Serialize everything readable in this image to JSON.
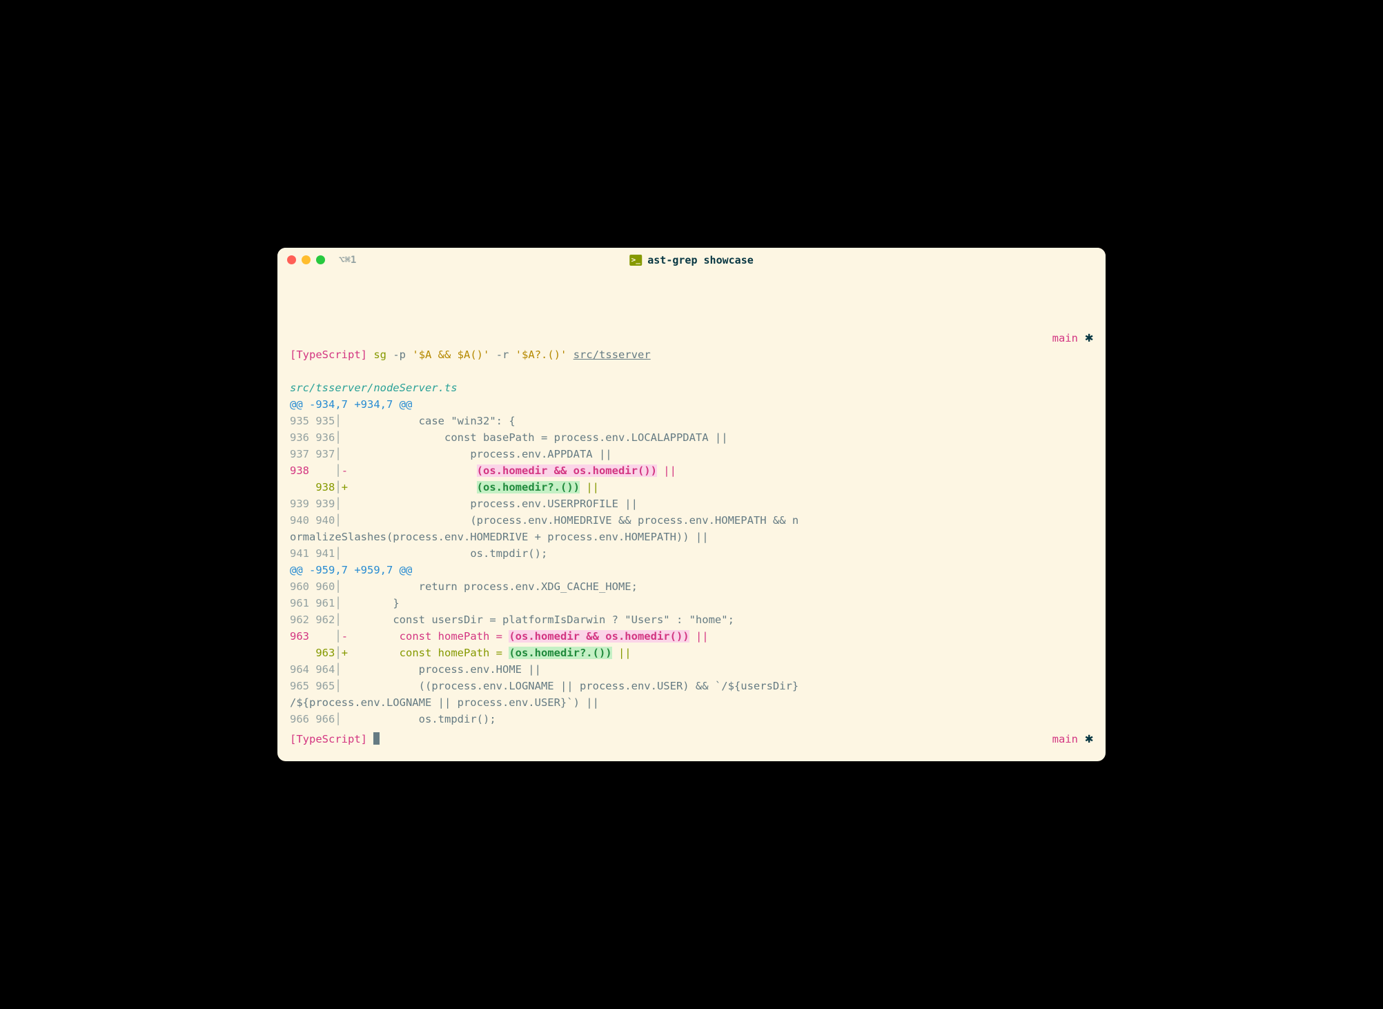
{
  "titlebar": {
    "tab_label": "⌥⌘1",
    "icon_glyph": ">_",
    "title": "ast-grep showcase"
  },
  "prompt1": {
    "lang": "[TypeScript]",
    "cmd": "sg",
    "flag_p": "-p",
    "pattern": "'$A && $A()'",
    "flag_r": "-r",
    "replace": "'$A?.()'",
    "path": "src/tsserver",
    "branch": "main",
    "star": "✱"
  },
  "file": "src/tsserver/nodeServer.ts",
  "hunk1": {
    "header": "@@ -934,7 +934,7 @@",
    "lines": [
      {
        "l": "935",
        "r": "935",
        "pre": "            case \"win32\": {"
      },
      {
        "l": "936",
        "r": "936",
        "pre": "                const basePath = process.env.LOCALAPPDATA ||"
      },
      {
        "l": "937",
        "r": "937",
        "pre": "                    process.env.APPDATA ||"
      }
    ],
    "del": {
      "l": "938",
      "r": "   ",
      "sign": "-",
      "pre": "                    ",
      "hl": "(os.homedir && os.homedir())",
      "post": " ||"
    },
    "add": {
      "l": "   ",
      "r": "938",
      "sign": "+",
      "pre": "                    ",
      "hl": "(os.homedir?.())",
      "post": " ||"
    },
    "after": [
      {
        "l": "939",
        "r": "939",
        "pre": "                    process.env.USERPROFILE ||"
      },
      {
        "l": "940",
        "r": "940",
        "pre": "                    (process.env.HOMEDRIVE && process.env.HOMEPATH && n"
      },
      {
        "wrap": "ormalizeSlashes(process.env.HOMEDRIVE + process.env.HOMEPATH)) ||"
      },
      {
        "l": "941",
        "r": "941",
        "pre": "                    os.tmpdir();"
      }
    ]
  },
  "hunk2": {
    "header": "@@ -959,7 +959,7 @@",
    "lines": [
      {
        "l": "960",
        "r": "960",
        "pre": "            return process.env.XDG_CACHE_HOME;"
      },
      {
        "l": "961",
        "r": "961",
        "pre": "        }"
      },
      {
        "l": "962",
        "r": "962",
        "pre": "        const usersDir = platformIsDarwin ? \"Users\" : \"home\";"
      }
    ],
    "del": {
      "l": "963",
      "r": "   ",
      "sign": "-",
      "pre": "        const homePath = ",
      "hl": "(os.homedir && os.homedir())",
      "post": " ||"
    },
    "add": {
      "l": "   ",
      "r": "963",
      "sign": "+",
      "pre": "        const homePath = ",
      "hl": "(os.homedir?.())",
      "post": " ||"
    },
    "after": [
      {
        "l": "964",
        "r": "964",
        "pre": "            process.env.HOME ||"
      },
      {
        "l": "965",
        "r": "965",
        "pre": "            ((process.env.LOGNAME || process.env.USER) && `/${usersDir}"
      },
      {
        "wrap": "/${process.env.LOGNAME || process.env.USER}`) ||"
      },
      {
        "l": "966",
        "r": "966",
        "pre": "            os.tmpdir();"
      }
    ]
  },
  "prompt2": {
    "lang": "[TypeScript]",
    "branch": "main",
    "star": "✱"
  }
}
